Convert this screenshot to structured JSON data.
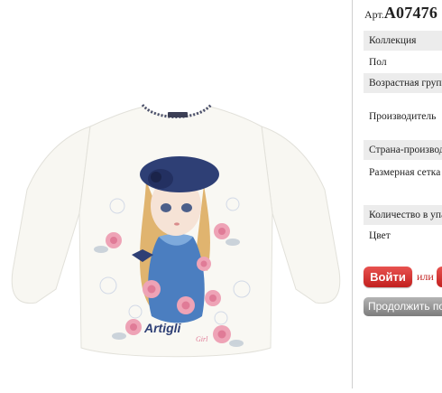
{
  "product": {
    "article_prefix": "Арт.",
    "article_code": "A07476",
    "image_logo_text": "Artigli",
    "image_logo_sub": "Girl"
  },
  "specs": [
    {
      "label": "Коллекция"
    },
    {
      "label": "Пол"
    },
    {
      "label": "Возрастная группа"
    },
    {
      "label": "Производитель"
    },
    {
      "label": "Страна-производитель"
    },
    {
      "label": "Размерная сетка"
    },
    {
      "label": "Количество в упаковке"
    },
    {
      "label": "Цвет"
    }
  ],
  "actions": {
    "login_label": "Войти",
    "or_label": "или",
    "continue_label": "Продолжить покупки"
  },
  "colors": {
    "login_red": "#d0302d",
    "continue_grey": "#8f8f8f",
    "spec_shade": "#ececec"
  }
}
